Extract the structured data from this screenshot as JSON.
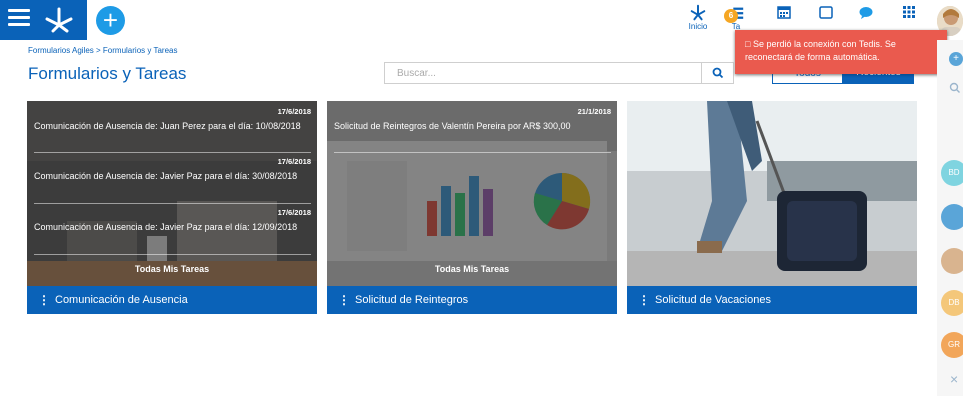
{
  "header": {
    "nav": [
      {
        "label": "Inicio",
        "icon": "home-icon"
      },
      {
        "label": "Ta",
        "icon": "tasks-icon",
        "badge": "6"
      },
      {
        "label": "",
        "icon": "calendar-icon"
      },
      {
        "label": "",
        "icon": "window-icon"
      },
      {
        "label": "",
        "icon": "chat-icon"
      },
      {
        "label": "",
        "icon": "apps-grid-icon"
      }
    ]
  },
  "breadcrumb": "Formularios Agiles > Formularios y Tareas",
  "page_title": "Formularios y Tareas",
  "search": {
    "placeholder": "Buscar..."
  },
  "toggle": {
    "all": "Todos",
    "recent": "Recientes"
  },
  "toast": "Se perdió la conexión con Tedis. Se reconectará de forma automática.",
  "cards": [
    {
      "title": "Comunicación de Ausencia",
      "items": [
        {
          "date": "17/6/2018",
          "text": "Comunicación de Ausencia de: Juan Perez para el día: 10/08/2018"
        },
        {
          "date": "17/6/2018",
          "text": "Comunicación de Ausencia de: Javier Paz para el día: 30/08/2018"
        },
        {
          "date": "17/6/2018",
          "text": "Comunicación de Ausencia de: Javier Paz para el día: 12/09/2018"
        }
      ],
      "all_link": "Todas Mis Tareas"
    },
    {
      "title": "Solicitud de Reintegros",
      "items": [
        {
          "date": "21/1/2018",
          "text": "Solicitud de Reintegros de Valentín Pereira por AR$ 300,00"
        }
      ],
      "all_link": "Todas Mis Tareas"
    },
    {
      "title": "Solicitud de Vacaciones"
    }
  ],
  "rail": {
    "chips": [
      {
        "initials": "BD",
        "color": "#7fd4e0"
      },
      {
        "initials": "",
        "color": "#5aa5d8"
      },
      {
        "initials": "",
        "color": "#d9b48f"
      },
      {
        "initials": "DB",
        "color": "#f4c77a"
      },
      {
        "initials": "GR",
        "color": "#f2a65a"
      }
    ],
    "close": "×"
  }
}
